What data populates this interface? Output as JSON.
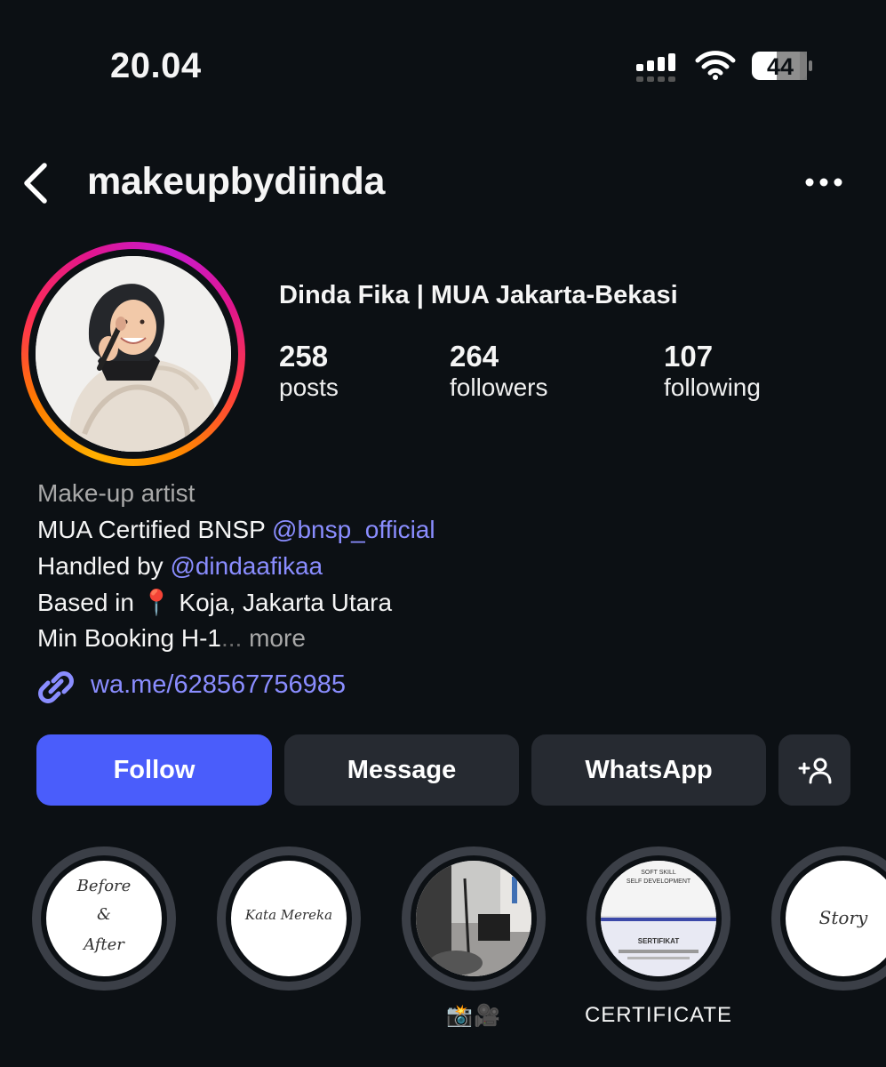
{
  "status_bar": {
    "time": "20.04",
    "battery": "44"
  },
  "header": {
    "username": "makeupbydiinda"
  },
  "profile": {
    "display_name": "Dinda Fika | MUA Jakarta-Bekasi",
    "stats": [
      {
        "value": "258",
        "label": "posts"
      },
      {
        "value": "264",
        "label": "followers"
      },
      {
        "value": "107",
        "label": "following"
      }
    ],
    "bio": {
      "category": "Make-up artist",
      "line1_text": "MUA Certified BNSP ",
      "line1_mention": "@bnsp_official",
      "line2_text": "Handled by ",
      "line2_mention": "@dindaafikaa",
      "line3_prefix": "Based in ",
      "line3_pin": "📍",
      "line3_text": " Koja, Jakarta Utara",
      "line4_text": "Min Booking H-1",
      "ellipsis": "...",
      "more": " more"
    },
    "link": "wa.me/628567756985"
  },
  "actions": {
    "follow": "Follow",
    "message": "Message",
    "whatsapp": "WhatsApp"
  },
  "highlights": [
    {
      "cover_text_1": "Before",
      "cover_text_2": "&",
      "cover_text_3": "After",
      "label": ""
    },
    {
      "cover_text": "Kata Mereka",
      "label": ""
    },
    {
      "label": "📸🎥"
    },
    {
      "cover_text_1": "SOFT SKILL",
      "cover_text_2": "SELF DEVELOPMENT",
      "cover_text_3": "SERTIFIKAT",
      "label": "CERTIFICATE"
    },
    {
      "cover_text": "Story",
      "label": ""
    }
  ],
  "colors": {
    "background": "#0c1014",
    "follow_button": "#4a5dfb",
    "secondary_button": "#262a31",
    "mention": "#8a8dff"
  }
}
